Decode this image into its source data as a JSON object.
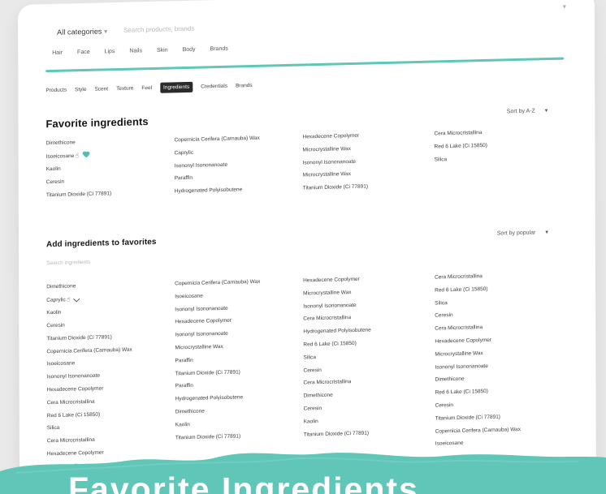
{
  "header": {
    "category": "All categories",
    "search_placeholder": "Search products, brands",
    "main_nav": [
      "Hair",
      "Face",
      "Lips",
      "Nails",
      "Skin",
      "Body",
      "Brands"
    ]
  },
  "tabs": [
    {
      "label": "Products",
      "active": false
    },
    {
      "label": "Style",
      "active": false
    },
    {
      "label": "Scent",
      "active": false
    },
    {
      "label": "Texture",
      "active": false
    },
    {
      "label": "Feel",
      "active": false
    },
    {
      "label": "Ingredients",
      "active": true
    },
    {
      "label": "Credentials",
      "active": false
    },
    {
      "label": "Brands",
      "active": false
    }
  ],
  "favorite_section": {
    "title": "Favorite ingredients",
    "sort_label": "Sort by A-Z",
    "columns": [
      [
        "Dimethicone",
        "Isoeicosane",
        "Kaolin",
        "Ceresin",
        "Titanium Dioxide (Ci 77891)"
      ],
      [
        "Copernicia Cerifera (Carnauba) Wax",
        "Caprylic",
        "Isononyl Isononanoate",
        "Paraffin",
        "Hydrogenated Polyisobutene"
      ],
      [
        "Hexadecene Copolymer",
        "Microcrystalline Wax",
        "Isononyl Isononanoate",
        "Microcrystalline Wax",
        "Titanium Dioxide (Ci 77891)"
      ],
      [
        "Cera Microcristallina",
        "Red 6 Lake (Ci 15850)",
        "Silica"
      ]
    ]
  },
  "add_section": {
    "title": "Add ingredients to favorites",
    "sort_label": "Sort by popular",
    "search_placeholder": "Search ingredients",
    "columns": [
      [
        "Dimethicone",
        "Caprylic",
        "Kaolin",
        "Ceresin",
        "Titanium Dioxide (Ci 77891)",
        "Copernicia Cerifera (Carnauba) Wax",
        "Isoeicosane",
        "Isononyl Isononanoate",
        "Hexadecene Copolymer",
        "Cera Microcristallina",
        "Red 6 Lake (Ci 15850)",
        "Silica",
        "Cera Microcristallina",
        "Hexadecene Copolymer",
        "Microcrystalline Wax"
      ],
      [
        "Copernicia Cerifera (Carnauba) Wax",
        "Isoeicosane",
        "Isononyl Isononanoate",
        "Hexadecene Copolymer",
        "Isononyl Isononanoate",
        "Microcrystalline Wax",
        "Paraffin",
        "Titanium Dioxide (Ci 77891)",
        "Paraffin",
        "Hydrogenated Polyisobutene",
        "Dimethicone",
        "Kaolin",
        "Titanium Dioxide (Ci 77891)"
      ],
      [
        "Hexadecene Copolymer",
        "Microcrystalline Wax",
        "Isononyl Isononanoate",
        "Cera Microcristallina",
        "Hydrogenated Polyisobutene",
        "Red 6 Lake (Ci 15850)",
        "Silica",
        "Ceresin",
        "Cera Microcristallina",
        "Dimethicone",
        "Ceresin",
        "Kaolin",
        "Titanium Dioxide (Ci 77891)"
      ],
      [
        "Cera Microcristallina",
        "Red 6 Lake (Ci 15850)",
        "Silica",
        "Ceresin",
        "Cera Microcristallina",
        "Hexadecene Copolymer",
        "Microcrystalline Wax",
        "Isononyl Isononanoate",
        "Dimethicone",
        "Red 6 Lake (Ci 15850)",
        "Ceresin",
        "Titanium Dioxide (Ci 77891)",
        "Copernicia Cerifera (Carnauba) Wax",
        "Isoeicosane"
      ]
    ]
  },
  "bottom_banner": "Favorite Ingredients",
  "colors": {
    "accent": "#5fc6b8",
    "page_bg": "#e9e9e9",
    "sheet_bg": "#ffffff"
  }
}
